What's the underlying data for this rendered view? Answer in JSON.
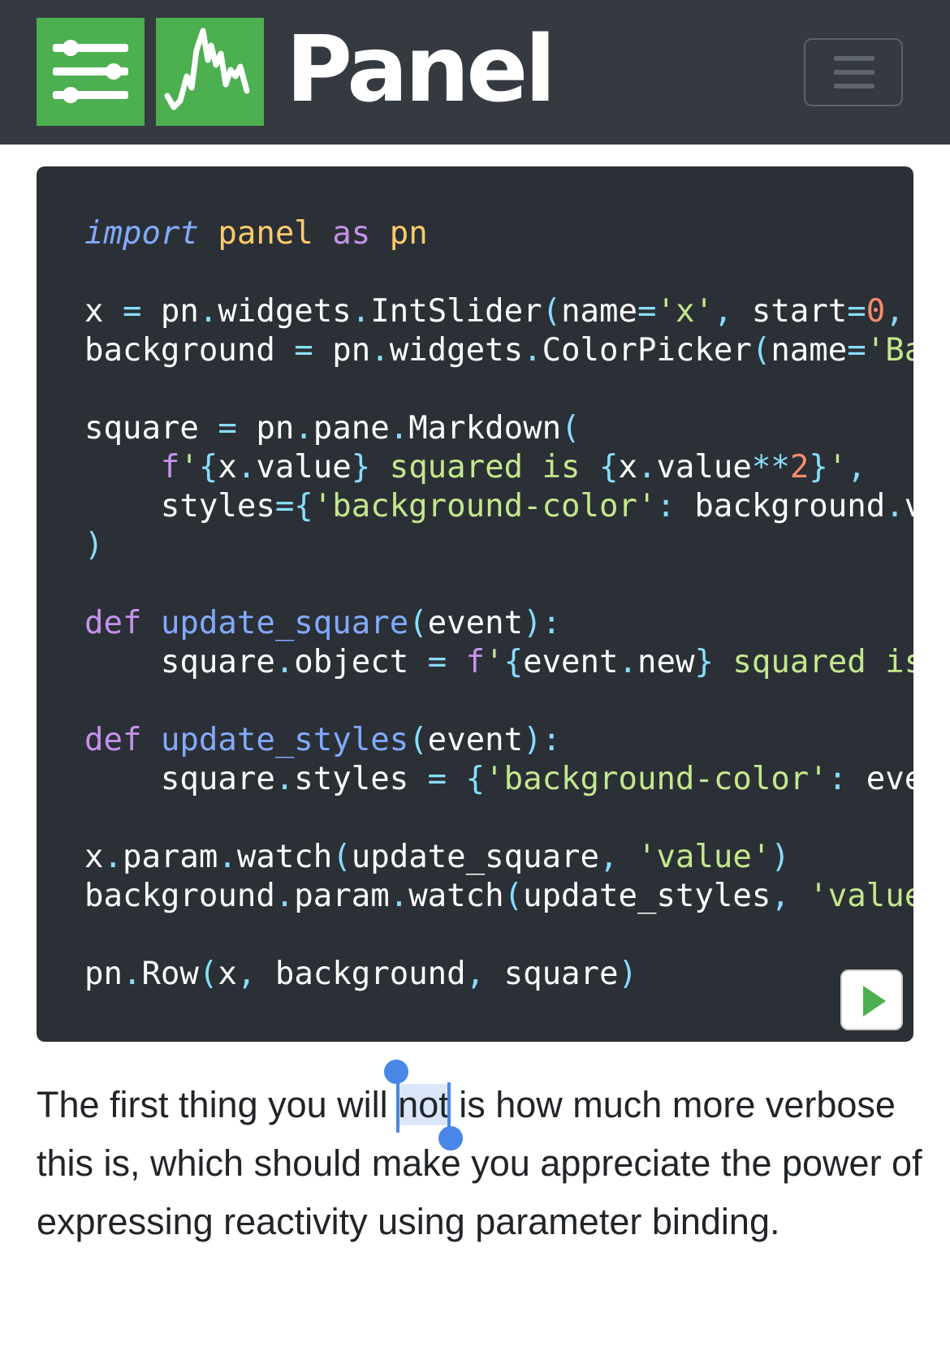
{
  "navbar": {
    "brand": "Panel",
    "logo_sliders_icon": "sliders-icon",
    "logo_chart_icon": "line-chart-icon",
    "menu_icon": "hamburger-menu-icon",
    "background_color": "#343a40",
    "logo_color": "#4caf50"
  },
  "code": {
    "background_color": "#2b3036",
    "lines": [
      [
        [
          "t-kw-italic",
          "import"
        ],
        [
          "t-plain",
          " "
        ],
        [
          "t-mod",
          "panel"
        ],
        [
          "t-plain",
          " "
        ],
        [
          "t-kw",
          "as"
        ],
        [
          "t-plain",
          " "
        ],
        [
          "t-mod",
          "pn"
        ]
      ],
      [],
      [
        [
          "t-plain",
          "x "
        ],
        [
          "t-punc",
          "="
        ],
        [
          "t-plain",
          " pn"
        ],
        [
          "t-punc",
          "."
        ],
        [
          "t-plain",
          "widgets"
        ],
        [
          "t-punc",
          "."
        ],
        [
          "t-plain",
          "IntSlider"
        ],
        [
          "t-punc",
          "("
        ],
        [
          "t-plain",
          "name"
        ],
        [
          "t-punc",
          "="
        ],
        [
          "t-str",
          "'x'"
        ],
        [
          "t-punc",
          ","
        ],
        [
          "t-plain",
          " start"
        ],
        [
          "t-punc",
          "="
        ],
        [
          "t-num",
          "0"
        ],
        [
          "t-punc",
          ","
        ]
      ],
      [
        [
          "t-plain",
          "background "
        ],
        [
          "t-punc",
          "="
        ],
        [
          "t-plain",
          " pn"
        ],
        [
          "t-punc",
          "."
        ],
        [
          "t-plain",
          "widgets"
        ],
        [
          "t-punc",
          "."
        ],
        [
          "t-plain",
          "ColorPicker"
        ],
        [
          "t-punc",
          "("
        ],
        [
          "t-plain",
          "name"
        ],
        [
          "t-punc",
          "="
        ],
        [
          "t-str",
          "'Ba"
        ]
      ],
      [],
      [
        [
          "t-plain",
          "square "
        ],
        [
          "t-punc",
          "="
        ],
        [
          "t-plain",
          " pn"
        ],
        [
          "t-punc",
          "."
        ],
        [
          "t-plain",
          "pane"
        ],
        [
          "t-punc",
          "."
        ],
        [
          "t-plain",
          "Markdown"
        ],
        [
          "t-punc",
          "("
        ]
      ],
      [
        [
          "t-plain",
          "    "
        ],
        [
          "t-kw",
          "f"
        ],
        [
          "t-str",
          "'"
        ],
        [
          "t-punc",
          "{"
        ],
        [
          "t-plain",
          "x"
        ],
        [
          "t-punc",
          "."
        ],
        [
          "t-plain",
          "value"
        ],
        [
          "t-punc",
          "}"
        ],
        [
          "t-str",
          " squared is "
        ],
        [
          "t-punc",
          "{"
        ],
        [
          "t-plain",
          "x"
        ],
        [
          "t-punc",
          "."
        ],
        [
          "t-plain",
          "value"
        ],
        [
          "t-punc",
          "**"
        ],
        [
          "t-num",
          "2"
        ],
        [
          "t-punc",
          "}"
        ],
        [
          "t-str",
          "'"
        ],
        [
          "t-punc",
          ","
        ]
      ],
      [
        [
          "t-plain",
          "    styles"
        ],
        [
          "t-punc",
          "={"
        ],
        [
          "t-str",
          "'background-color'"
        ],
        [
          "t-punc",
          ":"
        ],
        [
          "t-plain",
          " background"
        ],
        [
          "t-punc",
          "."
        ],
        [
          "t-plain",
          "v"
        ]
      ],
      [
        [
          "t-punc",
          ")"
        ]
      ],
      [],
      [
        [
          "t-kw",
          "def"
        ],
        [
          "t-plain",
          " "
        ],
        [
          "t-fn",
          "update_square"
        ],
        [
          "t-punc",
          "("
        ],
        [
          "t-plain",
          "event"
        ],
        [
          "t-punc",
          "):"
        ]
      ],
      [
        [
          "t-plain",
          "    square"
        ],
        [
          "t-punc",
          "."
        ],
        [
          "t-plain",
          "object "
        ],
        [
          "t-punc",
          "="
        ],
        [
          "t-plain",
          " "
        ],
        [
          "t-kw",
          "f"
        ],
        [
          "t-str",
          "'"
        ],
        [
          "t-punc",
          "{"
        ],
        [
          "t-plain",
          "event"
        ],
        [
          "t-punc",
          "."
        ],
        [
          "t-plain",
          "new"
        ],
        [
          "t-punc",
          "}"
        ],
        [
          "t-str",
          " squared is"
        ]
      ],
      [],
      [
        [
          "t-kw",
          "def"
        ],
        [
          "t-plain",
          " "
        ],
        [
          "t-fn",
          "update_styles"
        ],
        [
          "t-punc",
          "("
        ],
        [
          "t-plain",
          "event"
        ],
        [
          "t-punc",
          "):"
        ]
      ],
      [
        [
          "t-plain",
          "    square"
        ],
        [
          "t-punc",
          "."
        ],
        [
          "t-plain",
          "styles "
        ],
        [
          "t-punc",
          "="
        ],
        [
          "t-plain",
          " "
        ],
        [
          "t-punc",
          "{"
        ],
        [
          "t-str",
          "'background-color'"
        ],
        [
          "t-punc",
          ":"
        ],
        [
          "t-plain",
          " eve"
        ]
      ],
      [],
      [
        [
          "t-plain",
          "x"
        ],
        [
          "t-punc",
          "."
        ],
        [
          "t-plain",
          "param"
        ],
        [
          "t-punc",
          "."
        ],
        [
          "t-plain",
          "watch"
        ],
        [
          "t-punc",
          "("
        ],
        [
          "t-plain",
          "update_square"
        ],
        [
          "t-punc",
          ","
        ],
        [
          "t-plain",
          " "
        ],
        [
          "t-str",
          "'value'"
        ],
        [
          "t-punc",
          ")"
        ]
      ],
      [
        [
          "t-plain",
          "background"
        ],
        [
          "t-punc",
          "."
        ],
        [
          "t-plain",
          "param"
        ],
        [
          "t-punc",
          "."
        ],
        [
          "t-plain",
          "watch"
        ],
        [
          "t-punc",
          "("
        ],
        [
          "t-plain",
          "update_styles"
        ],
        [
          "t-punc",
          ","
        ],
        [
          "t-plain",
          " "
        ],
        [
          "t-str",
          "'value"
        ]
      ],
      [],
      [
        [
          "t-plain",
          "pn"
        ],
        [
          "t-punc",
          "."
        ],
        [
          "t-plain",
          "Row"
        ],
        [
          "t-punc",
          "("
        ],
        [
          "t-plain",
          "x"
        ],
        [
          "t-punc",
          ","
        ],
        [
          "t-plain",
          " background"
        ],
        [
          "t-punc",
          ","
        ],
        [
          "t-plain",
          " square"
        ],
        [
          "t-punc",
          ")"
        ]
      ]
    ],
    "run_icon": "play-icon"
  },
  "paragraph": {
    "before": "The first thing you will ",
    "selected": "not",
    "after": " is how much more verbose this is, which should make you appreciate the power of expressing reactivity using parameter binding."
  }
}
